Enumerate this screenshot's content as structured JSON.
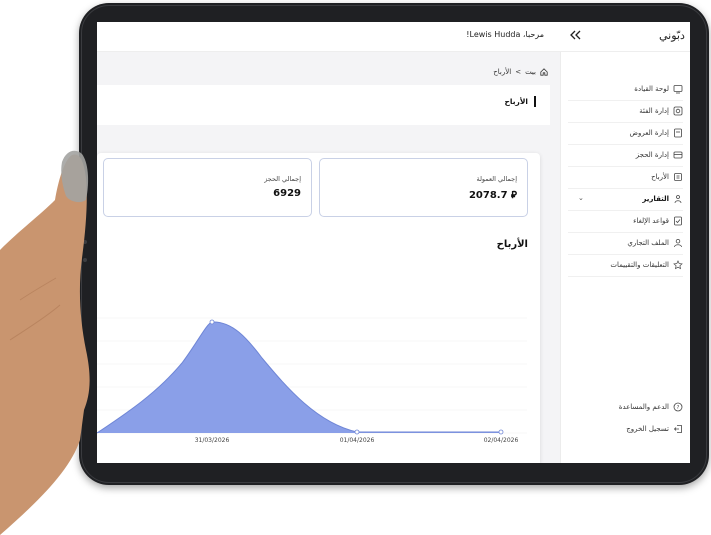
{
  "header": {
    "greeting": "مرحبا، Lewis Hudda!",
    "brand": "دبّوني"
  },
  "breadcrumb": {
    "home": "بيت",
    "separator": "<",
    "current": "الأرباح"
  },
  "tab": {
    "active_label": "الأرباح"
  },
  "stats": {
    "commission_label": "إجمالي العمولة",
    "commission_value": "2078.7",
    "currency_symbol": "⃁",
    "bookings_label": "إجمالي الحجز",
    "bookings_value": "6929"
  },
  "sidebar": {
    "items": [
      {
        "label": "لوحة القيادة",
        "icon": "dashboard-icon"
      },
      {
        "label": "إدارة الفئة",
        "icon": "category-icon"
      },
      {
        "label": "إدارة العروض",
        "icon": "offers-icon"
      },
      {
        "label": "إدارة الحجز",
        "icon": "booking-icon"
      },
      {
        "label": "الأرباح",
        "icon": "earnings-icon"
      },
      {
        "label": "التقارير",
        "icon": "reports-icon"
      },
      {
        "label": "قواعد الإلغاء",
        "icon": "cancel-rules-icon"
      },
      {
        "label": "الملف التجاري",
        "icon": "profile-icon"
      },
      {
        "label": "التعليقات والتقييمات",
        "icon": "reviews-icon"
      }
    ],
    "support": "الدعم والمساعدة",
    "logout": "تسجيل الخروج"
  },
  "chart_data": {
    "type": "area",
    "title": "الأرباح",
    "categories": [
      "31/03/2026",
      "01/04/2026",
      "02/04/2026"
    ],
    "color": "#8a9fe8",
    "line_color": "#6f86d6"
  }
}
